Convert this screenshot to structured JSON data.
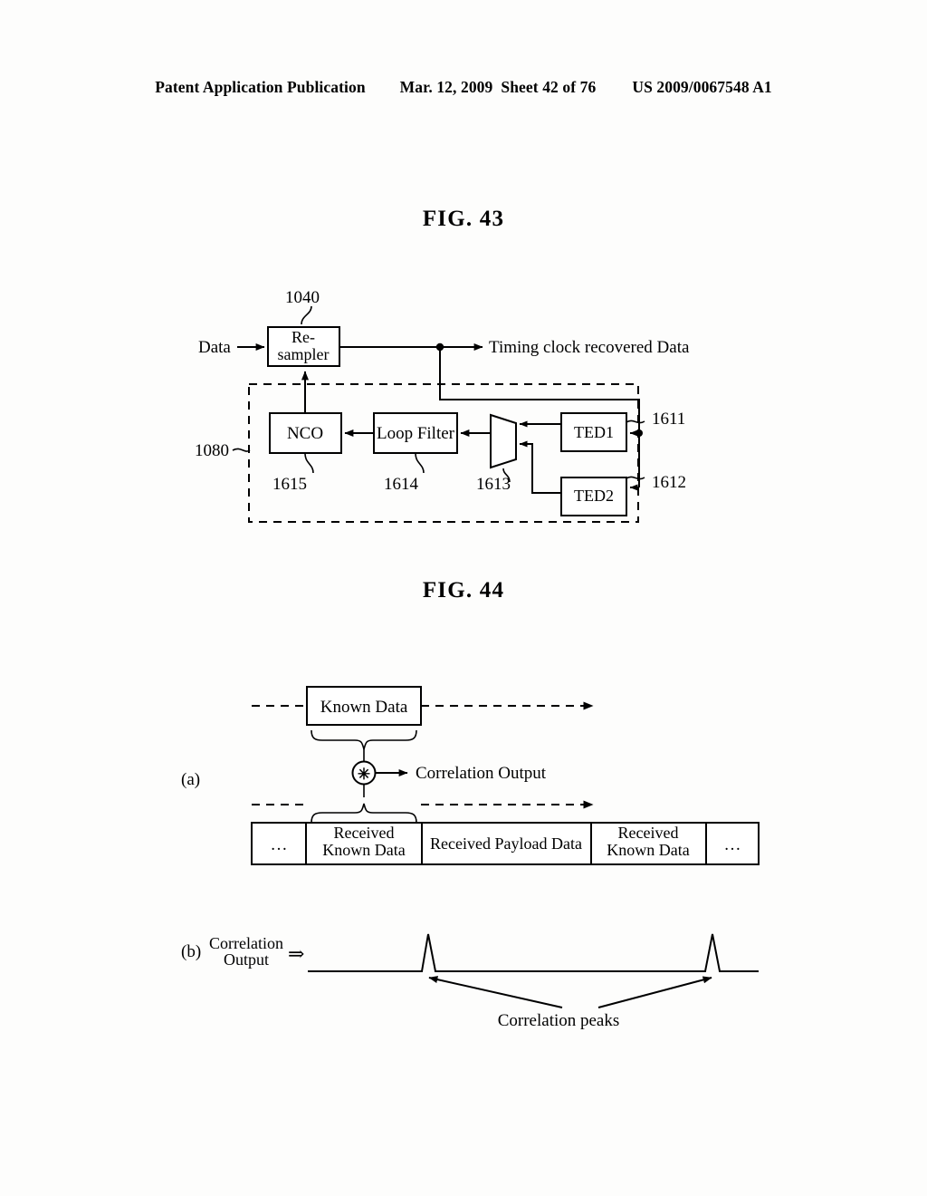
{
  "header": {
    "publication": "Patent Application Publication",
    "date": "Mar. 12, 2009",
    "sheet": "Sheet 42 of 76",
    "patent_number": "US 2009/0067548 A1"
  },
  "fig43": {
    "title": "FIG.  43",
    "input_label": "Data",
    "output_label": "Timing clock recovered Data",
    "resampler_label": "Re-\nsampler",
    "resampler_line1": "Re-",
    "resampler_line2": "sampler",
    "resampler_ref": "1040",
    "group_ref": "1080",
    "blocks": [
      {
        "label": "NCO",
        "ref": "1615"
      },
      {
        "label": "Loop Filter",
        "ref": "1614"
      },
      {
        "label": "MUX",
        "ref": "1613"
      },
      {
        "label": "TED1",
        "ref": "1611"
      },
      {
        "label": "TED2",
        "ref": "1612"
      }
    ]
  },
  "fig44": {
    "title": "FIG.  44",
    "part_a_label": "(a)",
    "part_b_label": "(b)",
    "known_data_label": "Known Data",
    "correlator_symbol": "✳",
    "correlation_output_label": "Correlation Output",
    "stream_cells": [
      "…",
      "Received\nKnown Data",
      "Received Payload Data",
      "Received\nKnown Data",
      "…"
    ],
    "stream_cell_0": "…",
    "stream_cell_1_line1": "Received",
    "stream_cell_1_line2": "Known Data",
    "stream_cell_2": "Received Payload Data",
    "stream_cell_3_line1": "Received",
    "stream_cell_3_line2": "Known Data",
    "stream_cell_4": "…",
    "part_b_title_line1": "Correlation",
    "part_b_title_line2": "Output",
    "part_b_arrow": "⇒",
    "peaks_annotation": "Correlation peaks"
  }
}
